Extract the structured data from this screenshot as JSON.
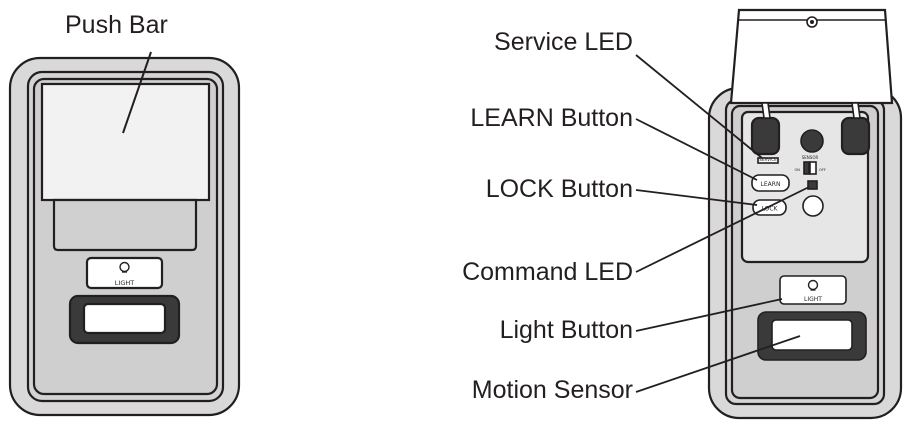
{
  "left_unit": {
    "label_push_bar": "Push Bar",
    "light_button_text": "LIGHT"
  },
  "right_unit": {
    "labels": {
      "service_led": "Service LED",
      "learn_button": "LEARN Button",
      "lock_button": "LOCK Button",
      "command_led": "Command LED",
      "light_button": "Light Button",
      "motion_sensor": "Motion Sensor"
    },
    "panel": {
      "service_text": "SERVICE",
      "learn_text": "LEARN",
      "lock_text": "LOCK",
      "sensor_text": "SENSOR",
      "on_text": "ON",
      "off_text": "OFF",
      "light_button_text": "LIGHT"
    }
  },
  "colors": {
    "outline": "#231f20",
    "device_gray": "#d9d9d9",
    "panel_gray": "#e6e6e6",
    "dark_part": "#3a3a3a"
  }
}
